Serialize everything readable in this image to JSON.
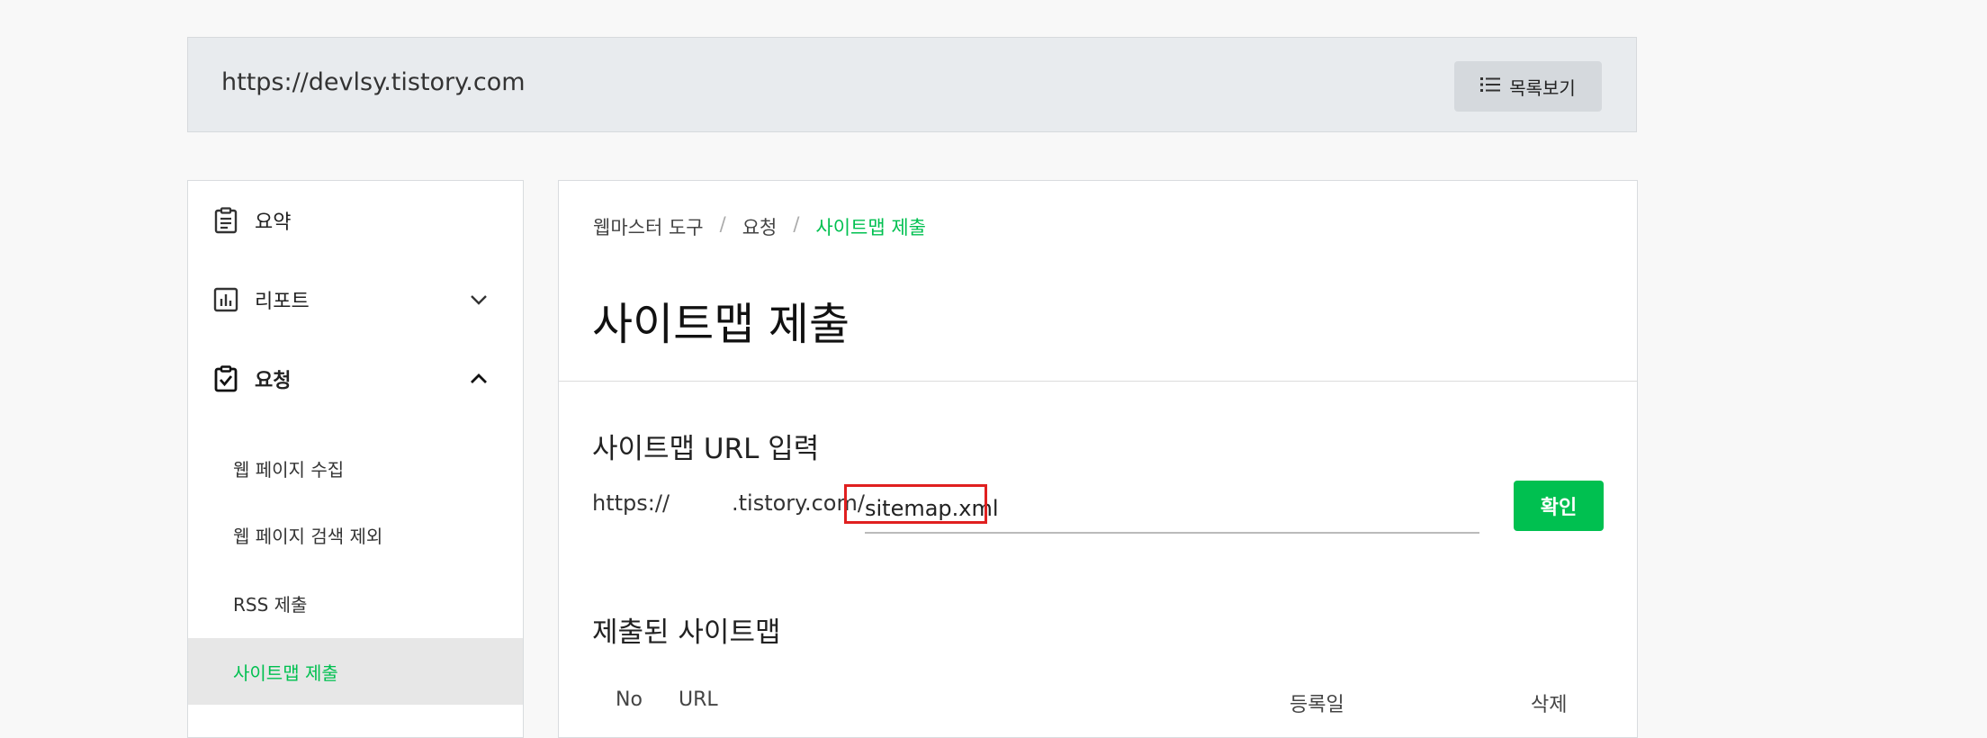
{
  "site": {
    "url": "https://devlsy.tistory.com",
    "list_button": "목록보기"
  },
  "sidebar": {
    "items": [
      {
        "label": "요약",
        "icon": "clipboard-list-icon"
      },
      {
        "label": "리포트",
        "icon": "bar-chart-icon"
      },
      {
        "label": "요청",
        "icon": "clipboard-check-icon"
      }
    ],
    "sub_items": [
      {
        "label": "웹 페이지 수집"
      },
      {
        "label": "웹 페이지 검색 제외"
      },
      {
        "label": "RSS 제출"
      },
      {
        "label": "사이트맵 제출",
        "active": true
      }
    ]
  },
  "main": {
    "breadcrumb": [
      "웹마스터 도구",
      "요청",
      "사이트맵 제출"
    ],
    "title": "사이트맵 제출",
    "url_section": {
      "title": "사이트맵 URL 입력",
      "prefix": "https://",
      "domain": ".tistory.com/",
      "input_value": "sitemap.xml",
      "confirm_label": "확인"
    },
    "submitted_section": {
      "title": "제출된 사이트맵",
      "columns": [
        "No",
        "URL",
        "등록일",
        "삭제"
      ]
    }
  },
  "colors": {
    "accent": "#00c050",
    "highlight": "#e02020"
  }
}
